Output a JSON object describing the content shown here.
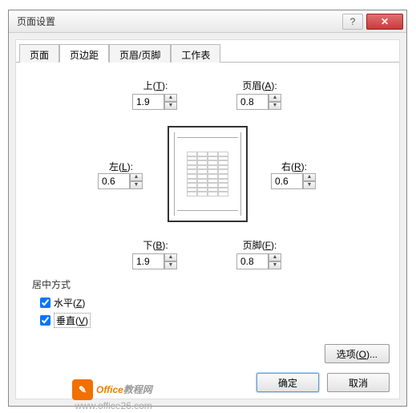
{
  "dialog": {
    "title": "页面设置"
  },
  "tabs": {
    "t0": "页面",
    "t1": "页边距",
    "t2": "页眉/页脚",
    "t3": "工作表"
  },
  "margins": {
    "top_label_pre": "上(",
    "top_label_u": "T",
    "top_label_suf": "):",
    "top_value": "1.9",
    "header_label_pre": "页眉(",
    "header_label_u": "A",
    "header_label_suf": "):",
    "header_value": "0.8",
    "left_label_pre": "左(",
    "left_label_u": "L",
    "left_label_suf": "):",
    "left_value": "0.6",
    "right_label_pre": "右(",
    "right_label_u": "R",
    "right_label_suf": "):",
    "right_value": "0.6",
    "bottom_label_pre": "下(",
    "bottom_label_u": "B",
    "bottom_label_suf": "):",
    "bottom_value": "1.9",
    "footer_label_pre": "页脚(",
    "footer_label_u": "F",
    "footer_label_suf": "):",
    "footer_value": "0.8"
  },
  "center": {
    "title": "居中方式",
    "horiz_pre": "水平(",
    "horiz_u": "Z",
    "horiz_suf": ")",
    "vert_pre": "垂直(",
    "vert_u": "V",
    "vert_suf": ")"
  },
  "buttons": {
    "options_pre": "选项(",
    "options_u": "O",
    "options_suf": ")...",
    "ok": "确定",
    "cancel": "取消"
  },
  "watermark": {
    "icon": "✎",
    "brand1": "Office",
    "brand2": "教程网",
    "url": "www.office26.com"
  }
}
